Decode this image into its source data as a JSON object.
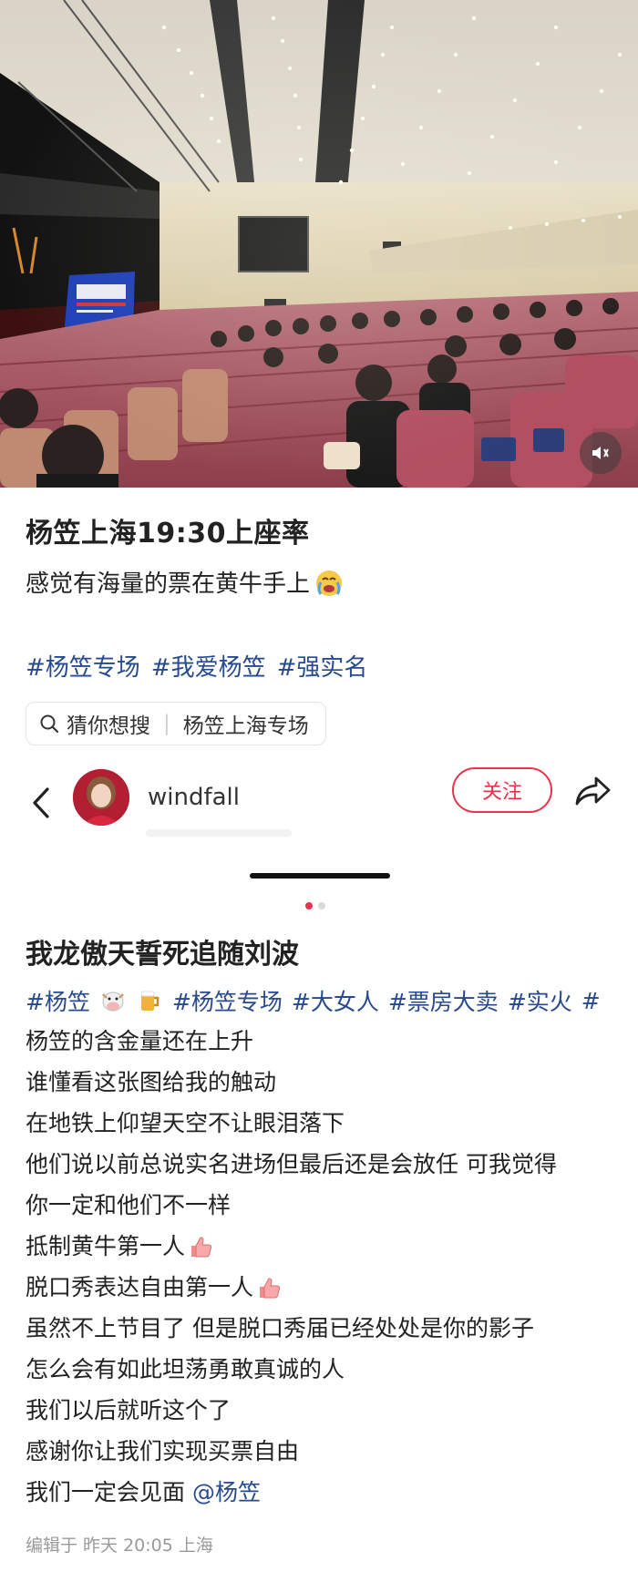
{
  "post1": {
    "title": "杨笠上海19:30上座率",
    "body": "感觉有海量的票在黄牛手上",
    "tags": [
      "#杨笠专场",
      "#我爱杨笠",
      "#强实名"
    ],
    "search_chip": {
      "label": "猜你想搜",
      "query": "杨笠上海专场"
    }
  },
  "author": {
    "name": "windfall",
    "follow_label": "关注"
  },
  "carousel": {
    "total": 2,
    "active": 1
  },
  "post2": {
    "title": "我龙傲天誓死追随刘波",
    "tags": [
      "#杨笠",
      "#杨笠专场",
      "#大女人",
      "#票房大卖",
      "#实火",
      "#"
    ],
    "lines": [
      "杨笠的含金量还在上升",
      "谁懂看这张图给我的触动",
      "在地铁上仰望天空不让眼泪落下",
      "他们说以前总说实名进场但最后还是会放任 可我觉得",
      "你一定和他们不一样",
      "抵制黄牛第一人",
      "脱口秀表达自由第一人",
      "虽然不上节目了 但是脱口秀届已经处处是你的影子",
      "怎么会有如此坦荡勇敢真诚的人",
      "我们以后就听这个了",
      "感谢你让我们实现买票自由",
      "我们一定会见面"
    ],
    "mention": "@杨笠",
    "edit_meta": "编辑于 昨天 20:05 上海"
  },
  "colors": {
    "accent": "#e8334b",
    "link": "#274a8f",
    "seat": "#a8404e"
  },
  "icons": {
    "back": "chevron-left-icon",
    "share": "share-arrow-icon",
    "search": "search-icon",
    "mute": "speaker-icon"
  }
}
